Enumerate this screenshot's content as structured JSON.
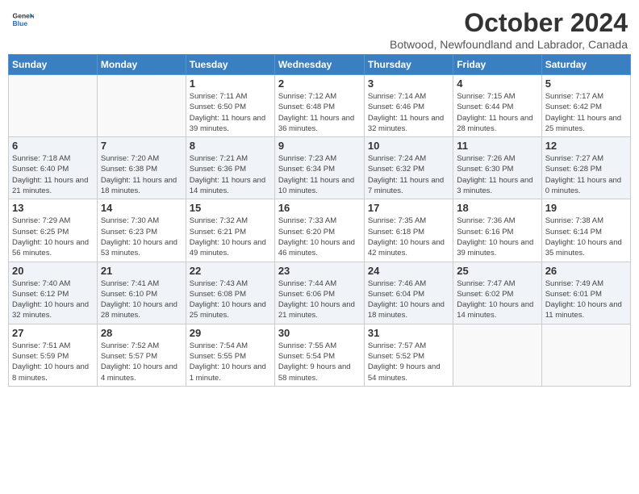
{
  "header": {
    "logo": {
      "general": "General",
      "blue": "Blue"
    },
    "title": "October 2024",
    "subtitle": "Botwood, Newfoundland and Labrador, Canada"
  },
  "weekdays": [
    "Sunday",
    "Monday",
    "Tuesday",
    "Wednesday",
    "Thursday",
    "Friday",
    "Saturday"
  ],
  "weeks": [
    [
      {
        "day": "",
        "info": ""
      },
      {
        "day": "",
        "info": ""
      },
      {
        "day": "1",
        "info": "Sunrise: 7:11 AM\nSunset: 6:50 PM\nDaylight: 11 hours and 39 minutes."
      },
      {
        "day": "2",
        "info": "Sunrise: 7:12 AM\nSunset: 6:48 PM\nDaylight: 11 hours and 36 minutes."
      },
      {
        "day": "3",
        "info": "Sunrise: 7:14 AM\nSunset: 6:46 PM\nDaylight: 11 hours and 32 minutes."
      },
      {
        "day": "4",
        "info": "Sunrise: 7:15 AM\nSunset: 6:44 PM\nDaylight: 11 hours and 28 minutes."
      },
      {
        "day": "5",
        "info": "Sunrise: 7:17 AM\nSunset: 6:42 PM\nDaylight: 11 hours and 25 minutes."
      }
    ],
    [
      {
        "day": "6",
        "info": "Sunrise: 7:18 AM\nSunset: 6:40 PM\nDaylight: 11 hours and 21 minutes."
      },
      {
        "day": "7",
        "info": "Sunrise: 7:20 AM\nSunset: 6:38 PM\nDaylight: 11 hours and 18 minutes."
      },
      {
        "day": "8",
        "info": "Sunrise: 7:21 AM\nSunset: 6:36 PM\nDaylight: 11 hours and 14 minutes."
      },
      {
        "day": "9",
        "info": "Sunrise: 7:23 AM\nSunset: 6:34 PM\nDaylight: 11 hours and 10 minutes."
      },
      {
        "day": "10",
        "info": "Sunrise: 7:24 AM\nSunset: 6:32 PM\nDaylight: 11 hours and 7 minutes."
      },
      {
        "day": "11",
        "info": "Sunrise: 7:26 AM\nSunset: 6:30 PM\nDaylight: 11 hours and 3 minutes."
      },
      {
        "day": "12",
        "info": "Sunrise: 7:27 AM\nSunset: 6:28 PM\nDaylight: 11 hours and 0 minutes."
      }
    ],
    [
      {
        "day": "13",
        "info": "Sunrise: 7:29 AM\nSunset: 6:25 PM\nDaylight: 10 hours and 56 minutes."
      },
      {
        "day": "14",
        "info": "Sunrise: 7:30 AM\nSunset: 6:23 PM\nDaylight: 10 hours and 53 minutes."
      },
      {
        "day": "15",
        "info": "Sunrise: 7:32 AM\nSunset: 6:21 PM\nDaylight: 10 hours and 49 minutes."
      },
      {
        "day": "16",
        "info": "Sunrise: 7:33 AM\nSunset: 6:20 PM\nDaylight: 10 hours and 46 minutes."
      },
      {
        "day": "17",
        "info": "Sunrise: 7:35 AM\nSunset: 6:18 PM\nDaylight: 10 hours and 42 minutes."
      },
      {
        "day": "18",
        "info": "Sunrise: 7:36 AM\nSunset: 6:16 PM\nDaylight: 10 hours and 39 minutes."
      },
      {
        "day": "19",
        "info": "Sunrise: 7:38 AM\nSunset: 6:14 PM\nDaylight: 10 hours and 35 minutes."
      }
    ],
    [
      {
        "day": "20",
        "info": "Sunrise: 7:40 AM\nSunset: 6:12 PM\nDaylight: 10 hours and 32 minutes."
      },
      {
        "day": "21",
        "info": "Sunrise: 7:41 AM\nSunset: 6:10 PM\nDaylight: 10 hours and 28 minutes."
      },
      {
        "day": "22",
        "info": "Sunrise: 7:43 AM\nSunset: 6:08 PM\nDaylight: 10 hours and 25 minutes."
      },
      {
        "day": "23",
        "info": "Sunrise: 7:44 AM\nSunset: 6:06 PM\nDaylight: 10 hours and 21 minutes."
      },
      {
        "day": "24",
        "info": "Sunrise: 7:46 AM\nSunset: 6:04 PM\nDaylight: 10 hours and 18 minutes."
      },
      {
        "day": "25",
        "info": "Sunrise: 7:47 AM\nSunset: 6:02 PM\nDaylight: 10 hours and 14 minutes."
      },
      {
        "day": "26",
        "info": "Sunrise: 7:49 AM\nSunset: 6:01 PM\nDaylight: 10 hours and 11 minutes."
      }
    ],
    [
      {
        "day": "27",
        "info": "Sunrise: 7:51 AM\nSunset: 5:59 PM\nDaylight: 10 hours and 8 minutes."
      },
      {
        "day": "28",
        "info": "Sunrise: 7:52 AM\nSunset: 5:57 PM\nDaylight: 10 hours and 4 minutes."
      },
      {
        "day": "29",
        "info": "Sunrise: 7:54 AM\nSunset: 5:55 PM\nDaylight: 10 hours and 1 minute."
      },
      {
        "day": "30",
        "info": "Sunrise: 7:55 AM\nSunset: 5:54 PM\nDaylight: 9 hours and 58 minutes."
      },
      {
        "day": "31",
        "info": "Sunrise: 7:57 AM\nSunset: 5:52 PM\nDaylight: 9 hours and 54 minutes."
      },
      {
        "day": "",
        "info": ""
      },
      {
        "day": "",
        "info": ""
      }
    ]
  ]
}
